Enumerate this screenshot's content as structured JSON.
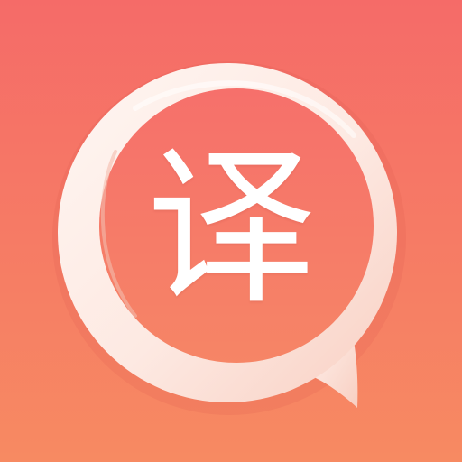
{
  "app_icon": {
    "glyph": "译",
    "glyph_color": "#ffffff",
    "gradient_top": "#f56b68",
    "gradient_bottom": "#f78a62",
    "ring_color": "#fdeee9",
    "icon": "speech-bubble-ring-icon"
  }
}
